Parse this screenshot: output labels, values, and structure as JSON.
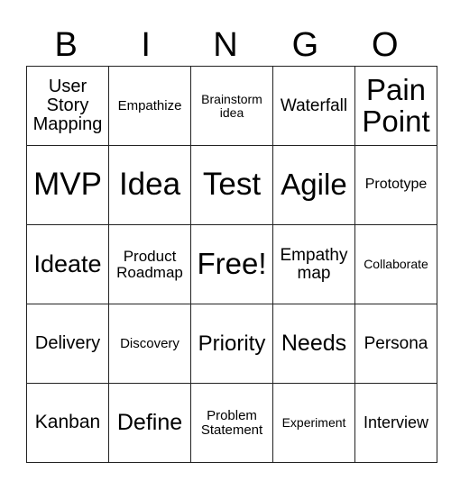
{
  "header": [
    "B",
    "I",
    "N",
    "G",
    "O"
  ],
  "cells": [
    [
      {
        "text": "User Story Mapping",
        "size": 20
      },
      {
        "text": "Empathize",
        "size": 15
      },
      {
        "text": "Brainstorm idea",
        "size": 14
      },
      {
        "text": "Waterfall",
        "size": 19
      },
      {
        "text": "Pain Point",
        "size": 33
      }
    ],
    [
      {
        "text": "MVP",
        "size": 35
      },
      {
        "text": "Idea",
        "size": 35
      },
      {
        "text": "Test",
        "size": 35
      },
      {
        "text": "Agile",
        "size": 33
      },
      {
        "text": "Prototype",
        "size": 16
      }
    ],
    [
      {
        "text": "Ideate",
        "size": 27
      },
      {
        "text": "Product Roadmap",
        "size": 17
      },
      {
        "text": "Free!",
        "size": 33
      },
      {
        "text": "Empathy map",
        "size": 19
      },
      {
        "text": "Collaborate",
        "size": 14
      }
    ],
    [
      {
        "text": "Delivery",
        "size": 20
      },
      {
        "text": "Discovery",
        "size": 15
      },
      {
        "text": "Priority",
        "size": 24
      },
      {
        "text": "Needs",
        "size": 25
      },
      {
        "text": "Persona",
        "size": 19
      }
    ],
    [
      {
        "text": "Kanban",
        "size": 21
      },
      {
        "text": "Define",
        "size": 25
      },
      {
        "text": "Problem Statement",
        "size": 15
      },
      {
        "text": "Experiment",
        "size": 14
      },
      {
        "text": "Interview",
        "size": 18
      }
    ]
  ]
}
